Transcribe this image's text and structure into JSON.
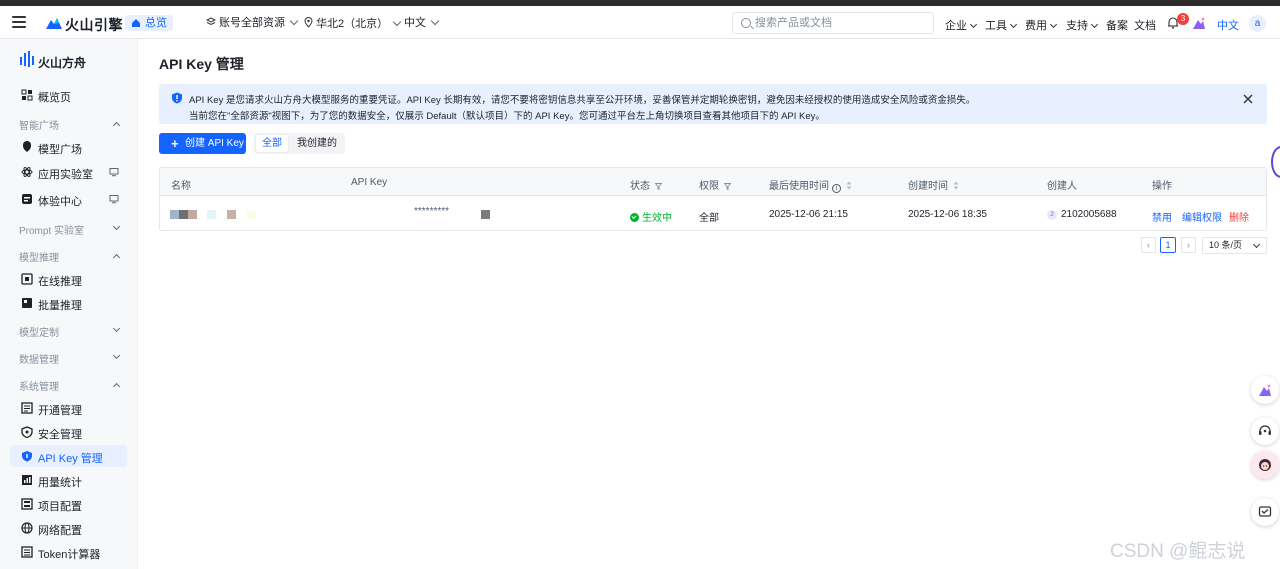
{
  "topbar": {
    "logo_text": "火山引擎",
    "home_label": "总览",
    "account_scope": "账号全部资源",
    "region": "华北2（北京）",
    "language_select": "中文",
    "search_placeholder": "搜索产品或文档",
    "menu": [
      "企业",
      "工具",
      "费用",
      "支持",
      "备案",
      "文档"
    ],
    "notification_count": "3",
    "lang_link": "中文",
    "avatar_letter": "a"
  },
  "sidebar": {
    "brand": "火山方舟",
    "items": [
      {
        "label": "概览页",
        "icon": "dashboard-icon"
      },
      {
        "group": "智能广场"
      },
      {
        "label": "模型广场",
        "icon": "model-square-icon"
      },
      {
        "label": "应用实验室",
        "icon": "app-lab-icon"
      },
      {
        "label": "体验中心",
        "icon": "experience-icon"
      },
      {
        "group": "Prompt 实验室"
      },
      {
        "group": "模型推理"
      },
      {
        "label": "在线推理",
        "icon": "online-inference-icon"
      },
      {
        "label": "批量推理",
        "icon": "batch-inference-icon"
      },
      {
        "group": "模型定制"
      },
      {
        "group": "数据管理"
      },
      {
        "group": "系统管理"
      },
      {
        "label": "开通管理",
        "icon": "activation-icon"
      },
      {
        "label": "安全管理",
        "icon": "security-icon"
      },
      {
        "label": "API Key 管理",
        "icon": "shield-key-icon",
        "active": true
      },
      {
        "label": "用量统计",
        "icon": "usage-icon"
      },
      {
        "label": "项目配置",
        "icon": "project-icon"
      },
      {
        "label": "网络配置",
        "icon": "network-icon"
      },
      {
        "label": "Token计算器",
        "icon": "calculator-icon"
      }
    ]
  },
  "main": {
    "title": "API Key 管理",
    "notice_line1": "API Key 是您请求火山方舟大模型服务的重要凭证。API Key 长期有效，请您不要将密钥信息共享至公开环境，妥善保管并定期轮换密钥，避免因未经授权的使用造成安全风险或资金损失。",
    "notice_line2": "当前您在\"全部资源\"视图下，为了您的数据安全，仅展示 Default（默认项目）下的 API Key。您可通过平台左上角切换项目查看其他项目下的 API Key。",
    "create_button": "创建 API Key",
    "filter_all": "全部",
    "filter_mine": "我创建的",
    "columns": [
      "名称",
      "API Key",
      "状态",
      "权限",
      "最后使用时间",
      "创建时间",
      "创建人",
      "操作"
    ],
    "row": {
      "api_key_masked": "*********",
      "status": "生效中",
      "permission": "全部",
      "last_used": "2025-12-06 21:15",
      "created": "2025-12-06 18:35",
      "creator": "2102005688",
      "creator_initial": "2",
      "actions": [
        "禁用",
        "编辑权限",
        "删除"
      ]
    },
    "pagination": {
      "current_page": "1",
      "page_size": "10 条/页"
    }
  },
  "watermark": "CSDN @鲲志说",
  "colors": {
    "primary": "#1664ff",
    "success": "#00b42a",
    "danger": "#f53f3f",
    "notice_bg": "#e8f0ff"
  }
}
